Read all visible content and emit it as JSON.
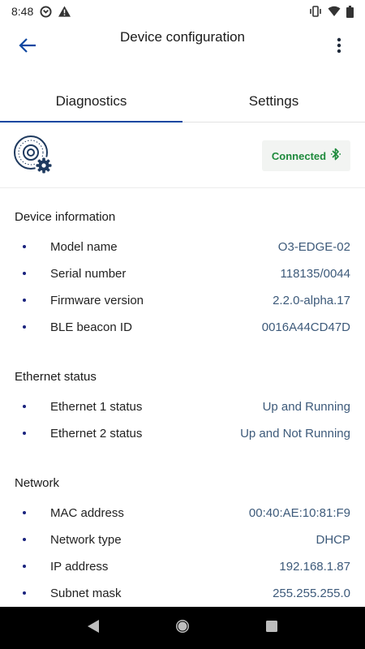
{
  "status_bar": {
    "time": "8:48"
  },
  "app_bar": {
    "title": "Device configuration"
  },
  "tabs": [
    {
      "label": "Diagnostics",
      "active": true
    },
    {
      "label": "Settings",
      "active": false
    }
  ],
  "connection": {
    "label": "Connected",
    "color": "#1e8a3c"
  },
  "sections": {
    "device_info": {
      "title": "Device information",
      "rows": [
        {
          "label": "Model name",
          "value": "O3-EDGE-02"
        },
        {
          "label": "Serial number",
          "value": "118135/0044"
        },
        {
          "label": "Firmware version",
          "value": "2.2.0-alpha.17"
        },
        {
          "label": "BLE beacon ID",
          "value": "0016A44CD47D"
        }
      ]
    },
    "ethernet": {
      "title": "Ethernet status",
      "rows": [
        {
          "label": "Ethernet 1 status",
          "value": "Up and Running"
        },
        {
          "label": "Ethernet 2 status",
          "value": "Up and Not Running"
        }
      ]
    },
    "network": {
      "title": "Network",
      "rows": [
        {
          "label": "MAC address",
          "value": "00:40:AE:10:81:F9"
        },
        {
          "label": "Network type",
          "value": "DHCP"
        },
        {
          "label": "IP address",
          "value": "192.168.1.87"
        },
        {
          "label": "Subnet mask",
          "value": "255.255.255.0"
        }
      ]
    }
  },
  "colors": {
    "accent": "#0d47a1",
    "value_text": "#3d5a7a",
    "bullet": "#1a237e"
  }
}
